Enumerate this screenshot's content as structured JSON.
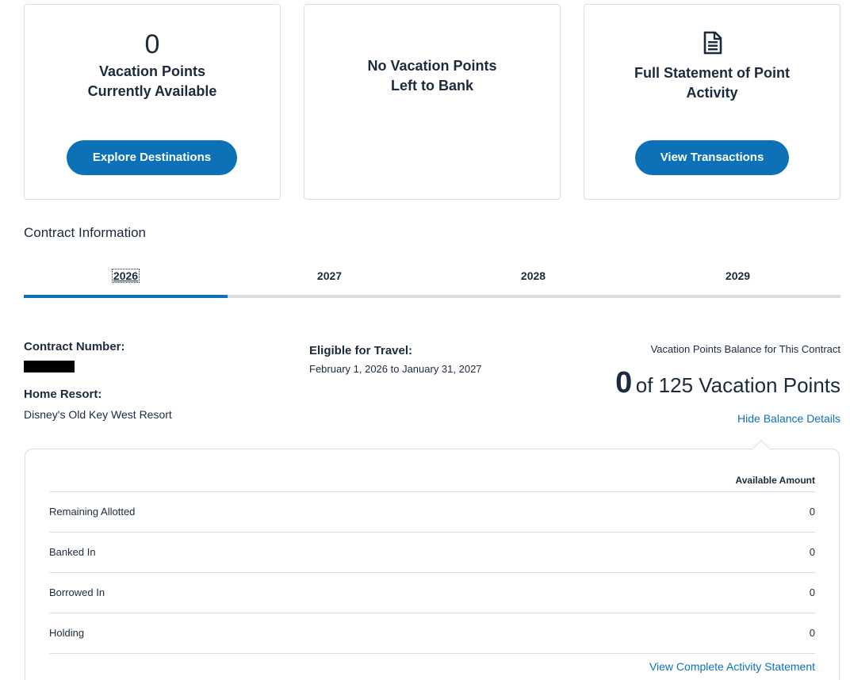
{
  "cards": {
    "available": {
      "points": "0",
      "title_line1": "Vacation Points",
      "title_line2": "Currently Available",
      "button": "Explore Destinations"
    },
    "bank": {
      "title_line1": "No Vacation Points",
      "title_line2": "Left to Bank"
    },
    "statement": {
      "icon": "document-icon",
      "title_line1": "Full Statement of Point",
      "title_line2": "Activity",
      "button": "View Transactions"
    }
  },
  "contract": {
    "section_title": "Contract Information",
    "tabs": [
      "2026",
      "2027",
      "2028",
      "2029"
    ],
    "active_tab": "2026",
    "number_label": "Contract Number:",
    "home_resort_label": "Home Resort:",
    "home_resort": "Disney's Old Key West Resort",
    "eligible_label": "Eligible for Travel:",
    "eligible_dates": "February 1, 2026 to January 31, 2027",
    "balance_label": "Vacation Points Balance for This Contract",
    "balance_current": "0",
    "balance_rest": "of 125 Vacation Points",
    "hide_link": "Hide Balance Details"
  },
  "details": {
    "column_header": "Available Amount",
    "rows": [
      {
        "label": "Remaining Allotted",
        "value": "0"
      },
      {
        "label": "Banked In",
        "value": "0"
      },
      {
        "label": "Borrowed In",
        "value": "0"
      },
      {
        "label": "Holding",
        "value": "0"
      }
    ],
    "activity_link": "View Complete Activity Statement"
  },
  "colors": {
    "accent": "#0c71b7",
    "text": "#1b2a3d",
    "border": "#d9dee3",
    "track": "#d6dde3"
  }
}
